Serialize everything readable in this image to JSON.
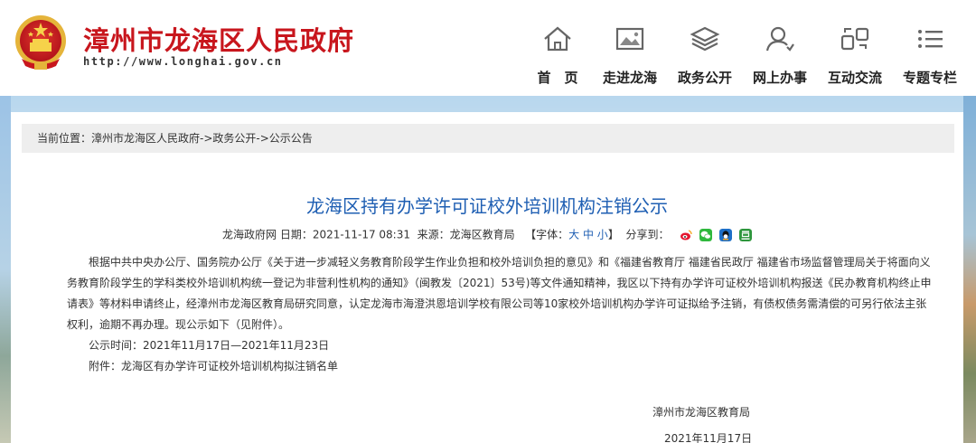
{
  "header": {
    "site_title": "漳州市龙海区人民政府",
    "site_url": "http://www.longhai.gov.cn"
  },
  "nav": [
    {
      "label": "首　页",
      "icon": "home-icon"
    },
    {
      "label": "走进龙海",
      "icon": "gallery-icon"
    },
    {
      "label": "政务公开",
      "icon": "layers-icon"
    },
    {
      "label": "网上办事",
      "icon": "user-service-icon"
    },
    {
      "label": "互动交流",
      "icon": "interaction-icon"
    },
    {
      "label": "专题专栏",
      "icon": "list-icon"
    }
  ],
  "breadcrumb": "当前位置：漳州市龙海区人民政府->政务公开->公示公告",
  "article": {
    "title": "龙海区持有办学许可证校外培训机构注销公示",
    "meta_source_site": "龙海政府网",
    "meta_date": "日期：2021-11-17 08:31",
    "meta_origin": "来源：龙海区教育局",
    "font_label_open": "【字体：",
    "font_large": "大",
    "font_medium": "中",
    "font_small": "小",
    "font_label_close": "】",
    "share_label": "分享到：",
    "share_icons": [
      "weibo-icon",
      "wechat-icon",
      "qq-icon",
      "douban-icon"
    ],
    "paragraph": "根据中共中央办公厅、国务院办公厅《关于进一步减轻义务教育阶段学生作业负担和校外培训负担的意见》和《福建省教育厅  福建省民政厅  福建省市场监督管理局关于将面向义务教育阶段学生的学科类校外培训机构统一登记为非营利性机构的通知》（闽教发〔2021〕53号)等文件通知精神，我区以下持有办学许可证校外培训机构报送《民办教育机构终止申请表》等材料申请终止，经漳州市龙海区教育局研究同意，认定龙海市海澄洪恩培训学校有限公司等10家校外培训机构办学许可证拟给予注销，有债权债务需清偿的可另行依法主张权利，逾期不再办理。现公示如下（见附件）。",
    "period": "公示时间：2021年11月17日—2021年11月23日",
    "attachment": "附件：龙海区有办学许可证校外培训机构拟注销名单",
    "signer": "漳州市龙海区教育局",
    "sign_date": "2021年11月17日"
  },
  "colors": {
    "brand_red": "#c8161d",
    "title_blue": "#1f5fb3",
    "breadcrumb_bg": "#eeeeee"
  }
}
